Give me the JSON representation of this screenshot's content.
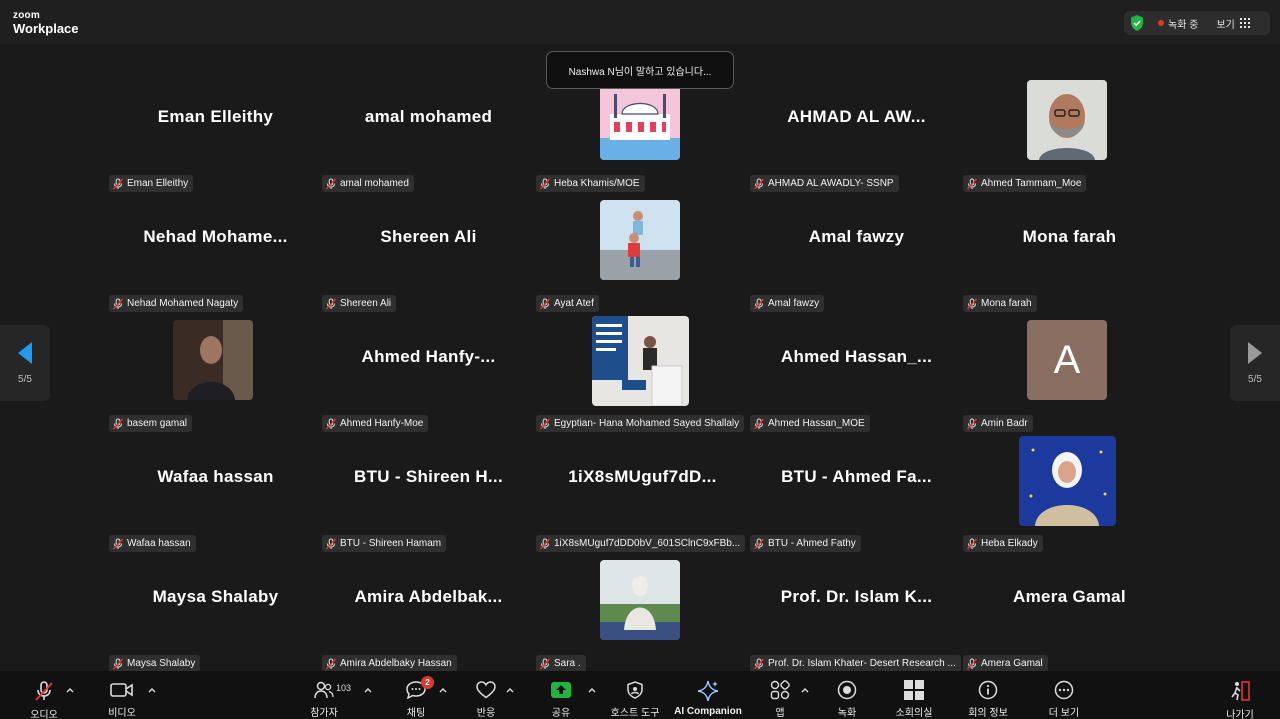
{
  "app": {
    "logo_top": "zoom",
    "logo_bottom": "Workplace"
  },
  "topright": {
    "recording": "녹화 중",
    "view": "보기"
  },
  "speaking_tooltip": "Nashwa N님이 말하고 있습니다...",
  "page_indicator": {
    "left": "5/5",
    "right": "5/5"
  },
  "tiles": [
    {
      "big": "Eman Elleithy",
      "label": "Eman Elleithy"
    },
    {
      "big": "amal mohamed",
      "label": "amal mohamed"
    },
    {
      "big": "",
      "label": "Heba Khamis/MOE"
    },
    {
      "big": "AHMAD AL AW...",
      "label": "AHMAD AL AWADLY- SSNP"
    },
    {
      "big": "",
      "label": "Ahmed Tammam_Moe"
    },
    {
      "big": "Nehad Mohame...",
      "label": "Nehad Mohamed Nagaty"
    },
    {
      "big": "Shereen Ali",
      "label": "Shereen Ali"
    },
    {
      "big": "",
      "label": "Ayat Atef"
    },
    {
      "big": "Amal fawzy",
      "label": "Amal fawzy"
    },
    {
      "big": "Mona farah",
      "label": "Mona farah"
    },
    {
      "big": "",
      "label": "basem gamal"
    },
    {
      "big": "Ahmed Hanfy-...",
      "label": "Ahmed Hanfy-Moe"
    },
    {
      "big": "",
      "label": "Egyptian- Hana Mohamed Sayed Shallaly"
    },
    {
      "big": "Ahmed Hassan_...",
      "label": "Ahmed Hassan_MOE"
    },
    {
      "big": "",
      "label": "Amin Badr",
      "initial": "A"
    },
    {
      "big": "Wafaa hassan",
      "label": "Wafaa hassan"
    },
    {
      "big": "BTU - Shireen H...",
      "label": "BTU - Shireen Hamam"
    },
    {
      "big": "1iX8sMUguf7dD...",
      "label": "1iX8sMUguf7dDD0bV_601SClnC9xFBb..."
    },
    {
      "big": "BTU - Ahmed Fa...",
      "label": "BTU - Ahmed Fathy"
    },
    {
      "big": "",
      "label": "Heba Elkady"
    },
    {
      "big": "Maysa Shalaby",
      "label": "Maysa Shalaby"
    },
    {
      "big": "Amira Abdelbak...",
      "label": "Amira Abdelbaky Hassan"
    },
    {
      "big": "",
      "label": "Sara ."
    },
    {
      "big": "Prof. Dr. Islam K...",
      "label": "Prof. Dr. Islam Khater- Desert Research ..."
    },
    {
      "big": "Amera Gamal",
      "label": "Amera Gamal"
    }
  ],
  "toolbar": {
    "audio": "오디오",
    "video": "비디오",
    "participants": "참가자",
    "participants_count": "103",
    "chat": "채팅",
    "chat_badge": "2",
    "reactions": "반응",
    "share": "공유",
    "host_tools": "호스트 도구",
    "ai_companion": "AI Companion",
    "apps": "앱",
    "record": "녹화",
    "breakout": "소회의실",
    "meeting_info": "회의 정보",
    "more": "더 보기",
    "leave": "나가기"
  },
  "colors": {
    "accent_blue": "#0e72ed",
    "share_green": "#1fb53f",
    "alert_red": "#e0372c"
  }
}
